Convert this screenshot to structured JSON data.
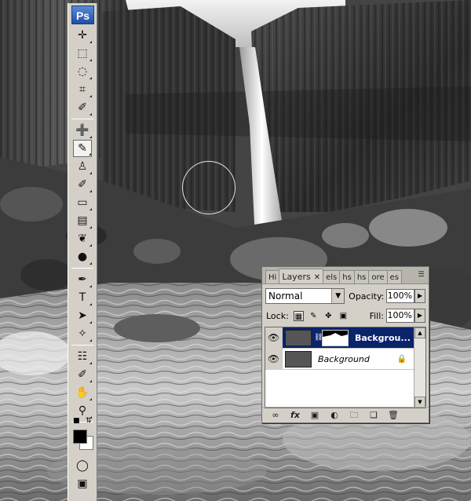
{
  "app": {
    "logo": "Ps"
  },
  "tools": [
    {
      "name": "move-tool-icon",
      "glyph": "✛"
    },
    {
      "name": "marquee-tool-icon",
      "glyph": "⬚"
    },
    {
      "name": "lasso-tool-icon",
      "glyph": "◌"
    },
    {
      "name": "crop-tool-icon",
      "glyph": "⌗"
    },
    {
      "name": "eyedropper-tool-icon",
      "glyph": "✐"
    },
    {
      "name": "healing-brush-tool-icon",
      "glyph": "➕"
    },
    {
      "name": "brush-tool-icon",
      "glyph": "✎"
    },
    {
      "name": "clone-stamp-tool-icon",
      "glyph": "♙"
    },
    {
      "name": "history-brush-tool-icon",
      "glyph": "✐"
    },
    {
      "name": "eraser-tool-icon",
      "glyph": "▭"
    },
    {
      "name": "gradient-tool-icon",
      "glyph": "▤"
    },
    {
      "name": "blur-tool-icon",
      "glyph": "❦"
    },
    {
      "name": "dodge-tool-icon",
      "glyph": "●"
    },
    {
      "name": "pen-tool-icon",
      "glyph": "✒"
    },
    {
      "name": "type-tool-icon",
      "glyph": "T"
    },
    {
      "name": "path-selection-tool-icon",
      "glyph": "➤"
    },
    {
      "name": "custom-shape-tool-icon",
      "glyph": "✧"
    },
    {
      "name": "notes-tool-icon",
      "glyph": "☷"
    },
    {
      "name": "color-sampler-tool-icon",
      "glyph": "✐"
    },
    {
      "name": "hand-tool-icon",
      "glyph": "✋"
    },
    {
      "name": "zoom-tool-icon",
      "glyph": "⚲"
    }
  ],
  "active_tool": "brush-tool-icon",
  "colors": {
    "foreground": "#000000",
    "background": "#ffffff",
    "selection": "#0a246a",
    "panel": "#d4d0c8"
  },
  "layers_panel": {
    "tabs": [
      {
        "label": "Hi"
      },
      {
        "label": "Layers",
        "close": "✕"
      },
      {
        "label": "els"
      },
      {
        "label": "hs"
      },
      {
        "label": "hs"
      },
      {
        "label": "ore"
      },
      {
        "label": "es"
      }
    ],
    "blend_mode": "Normal",
    "opacity_label": "Opacity:",
    "opacity_value": "100%",
    "lock_label": "Lock:",
    "fill_label": "Fill:",
    "fill_value": "100%",
    "layers": [
      {
        "name": "Backgrou...",
        "selected": true,
        "has_mask": true
      },
      {
        "name": "Background",
        "selected": false,
        "locked": true
      }
    ]
  }
}
